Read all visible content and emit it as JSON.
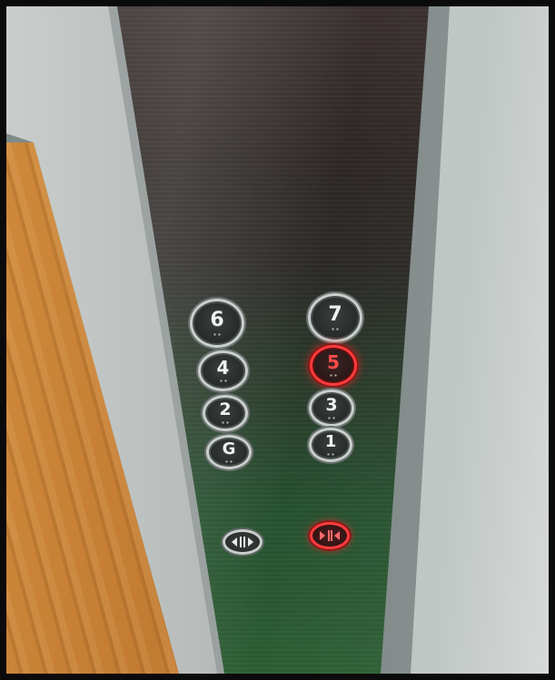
{
  "scene": {
    "colors": {
      "panel_top": "#2e2826",
      "panel_bottom": "#2d5e33",
      "wood": "#c27b32",
      "metal": "#b3b8b7",
      "lit_red": "#ff3a3a"
    }
  },
  "buttons": {
    "floor_6": {
      "label": "6",
      "lit": false
    },
    "floor_7": {
      "label": "7",
      "lit": false
    },
    "floor_4": {
      "label": "4",
      "lit": false
    },
    "floor_5": {
      "label": "5",
      "lit": true
    },
    "floor_2": {
      "label": "2",
      "lit": false
    },
    "floor_3": {
      "label": "3",
      "lit": false
    },
    "floor_g": {
      "label": "G",
      "lit": false
    },
    "floor_1": {
      "label": "1",
      "lit": false
    },
    "door_open": {
      "icon": "door-open-icon",
      "lit": false
    },
    "door_close": {
      "icon": "door-close-icon",
      "lit": true
    }
  }
}
